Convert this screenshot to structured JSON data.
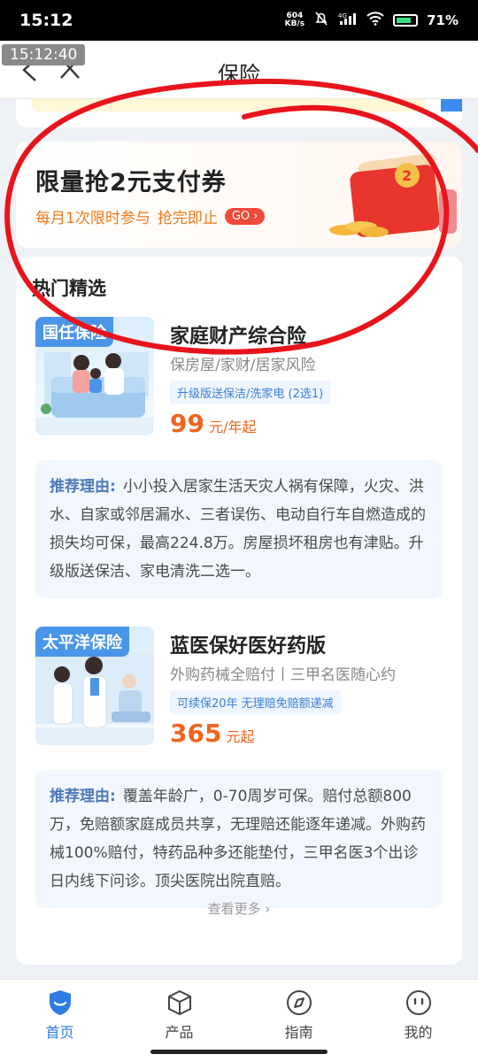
{
  "status_bar": {
    "time": "15:12",
    "net_speed_value": "604",
    "net_speed_unit": "KB/s",
    "network": "4G",
    "battery": "71%"
  },
  "nav": {
    "timestamp": "15:12:40",
    "title": "保险"
  },
  "promo": {
    "title": "限量抢2元支付券",
    "subtitle": "每月1次限时参与",
    "subtitle2": "抢完即止",
    "go_label": "GO",
    "art_digit": "2"
  },
  "hot": {
    "title": "热门精选",
    "products": [
      {
        "tag": "国任保险",
        "name": "家庭财产综合险",
        "desc": "保房屋/家财/居家风险",
        "badge": "升级版送保洁/洗家电 (2选1)",
        "price": "99",
        "unit": "元/年起",
        "reason_label": "推荐理由:",
        "reason": "小小投入居家生活天灾人祸有保障，火灾、洪水、自家或邻居漏水、三者误伤、电动自行车自燃造成的损失均可保，最高224.8万。房屋损坏租房也有津贴。升级版送保洁、家电清洗二选一。"
      },
      {
        "tag": "太平洋保险",
        "name": "蓝医保好医好药版",
        "desc": "外购药械全赔付丨三甲名医随心约",
        "badge": "可续保20年  无理赔免赔额递减",
        "price": "365",
        "unit": "元起",
        "reason_label": "推荐理由:",
        "reason": "覆盖年龄广，0-70周岁可保。赔付总额800万，免赔额家庭成员共享，无理赔还能逐年递减。外购药械100%赔付，特药品种多还能垫付，三甲名医3个出诊日内线下问诊。顶尖医院出院直赔。"
      }
    ],
    "more": "查看更多 ›"
  },
  "tabbar": {
    "items": [
      {
        "label": "首页",
        "icon": "shield-icon",
        "active": true
      },
      {
        "label": "产品",
        "icon": "box-icon",
        "active": false
      },
      {
        "label": "指南",
        "icon": "compass-icon",
        "active": false
      },
      {
        "label": "我的",
        "icon": "smile-icon",
        "active": false
      }
    ]
  },
  "colors": {
    "accent": "#2f7ae5",
    "price": "#f0641e",
    "promo_sub": "#f07a1a",
    "annotation": "#e8141c"
  }
}
